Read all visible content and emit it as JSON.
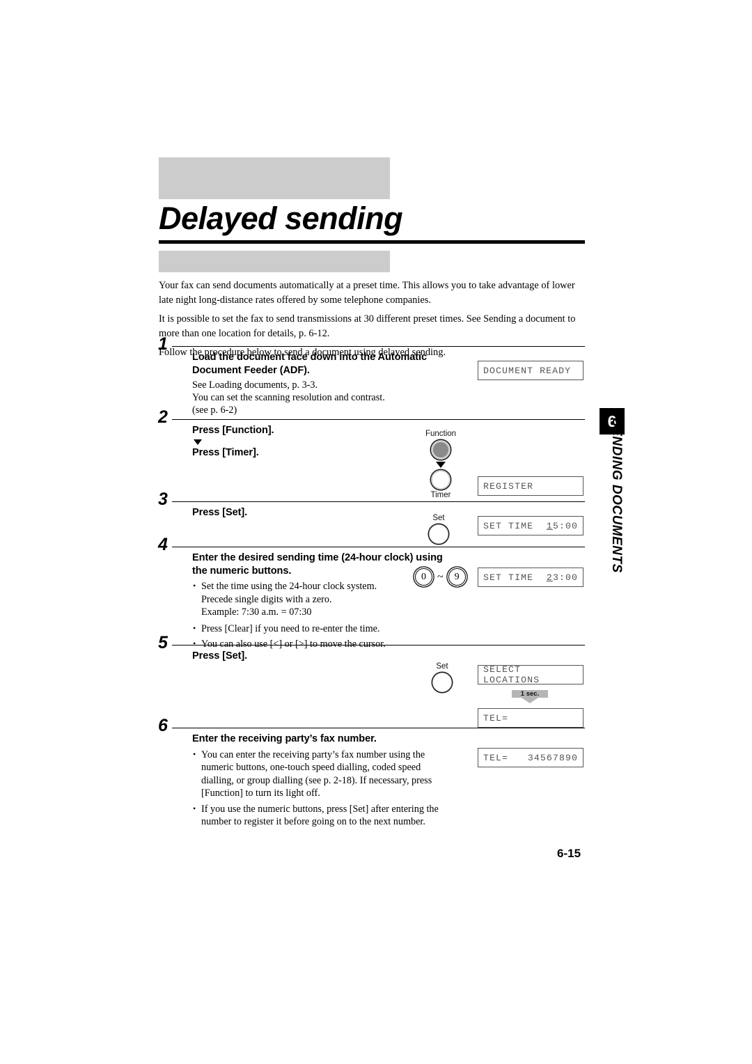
{
  "document": {
    "title": "Delayed sending",
    "page_number": "6-15",
    "side_tab": {
      "chapter": "6",
      "label": "SENDING DOCUMENTS"
    }
  },
  "intro": {
    "paragraphs": [
      "Your fax can send documents automatically at a preset time. This allows you to take advantage of lower late night long-distance rates offered by some telephone companies.",
      "It is possible to set the fax to send transmissions at 30 different preset times. See Sending a document to more than one location for details, p. 6-12.",
      "Follow the procedure below to send a document using delayed sending."
    ]
  },
  "steps": [
    {
      "number": "1",
      "heading": "Load the document face down into the Automatic Document Feeder (ADF).",
      "sub_lines": [
        "See Loading documents, p. 3-3.",
        "You can set the scanning resolution and contrast.",
        "(see p. 6-2)"
      ],
      "lcd": [
        {
          "left": "DOCUMENT READY",
          "right": ""
        }
      ]
    },
    {
      "number": "2",
      "heading": "Press [Function].",
      "heading2": "Press [Timer].",
      "keys": [
        {
          "label": "Function",
          "position": "above",
          "style": "filled"
        },
        {
          "label": "Timer",
          "position": "below",
          "style": "hollow"
        }
      ],
      "lcd": [
        {
          "left": "REGISTER",
          "right": ""
        }
      ]
    },
    {
      "number": "3",
      "heading": "Press [Set].",
      "keys": [
        {
          "label": "Set",
          "position": "above",
          "style": "thin"
        }
      ],
      "lcd": [
        {
          "left": "SET TIME",
          "right_cursor": "1",
          "right": "5:00"
        }
      ]
    },
    {
      "number": "4",
      "heading": "Enter the desired sending time (24-hour clock) using the numeric buttons.",
      "bullets": [
        "Set the time using the 24-hour clock system.",
        "Precede single digits with a zero.",
        "Example: 7:30 a.m. = 07:30",
        "Press [Clear] if you need to re-enter the time.",
        "You can also use [<] or [>] to move the cursor."
      ],
      "numeric_keys": {
        "from": "0",
        "to": "9",
        "separator": "~"
      },
      "lcd": [
        {
          "left": "SET TIME",
          "right_cursor": "2",
          "right": "3:00"
        }
      ]
    },
    {
      "number": "5",
      "heading": "Press [Set].",
      "keys": [
        {
          "label": "Set",
          "position": "above",
          "style": "thin"
        }
      ],
      "transition_label": "1 sec.",
      "lcd": [
        {
          "left": "SELECT LOCATIONS",
          "right": ""
        },
        {
          "left": "TEL=",
          "right": ""
        }
      ]
    },
    {
      "number": "6",
      "heading": "Enter the receiving party’s fax number.",
      "bullets": [
        "You can enter the receiving party’s fax number using the numeric buttons, one-touch speed dialling, coded speed dialling, or group dialling (see p. 2-18). If necessary, press [Function] to turn its light off.",
        "If you use the numeric buttons, press [Set] after entering the number to register it before going on to the next number."
      ],
      "lcd": [
        {
          "left": "TEL=",
          "right": "34567890"
        }
      ]
    }
  ]
}
